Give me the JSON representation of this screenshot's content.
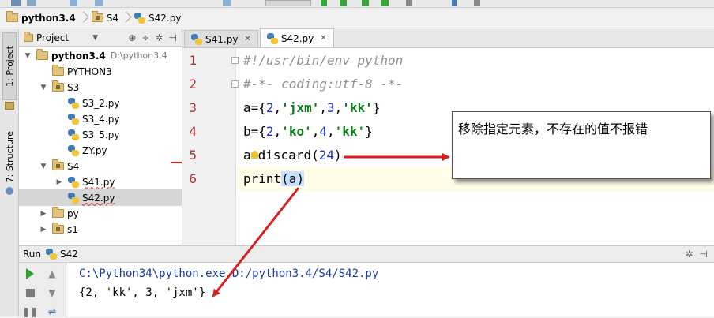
{
  "breadcrumb": {
    "project": "python3.4",
    "folder": "S4",
    "file": "S42.py"
  },
  "left_strip": {
    "project_tab": "1: Project",
    "structure_tab": "7: Structure"
  },
  "project_panel": {
    "title": "Project",
    "tree": [
      {
        "label": "python3.4",
        "hint": "D:\\python3.4",
        "kind": "folder",
        "depth": 0,
        "expanded": true,
        "bold": true
      },
      {
        "label": "PYTHON3",
        "kind": "folder",
        "depth": 1
      },
      {
        "label": "S3",
        "kind": "package",
        "depth": 1,
        "expanded": true
      },
      {
        "label": "S3_2.py",
        "kind": "py",
        "depth": 2
      },
      {
        "label": "S3_4.py",
        "kind": "py",
        "depth": 2
      },
      {
        "label": "S3_5.py",
        "kind": "py",
        "depth": 2
      },
      {
        "label": "ZY.py",
        "kind": "py",
        "depth": 2
      },
      {
        "label": "S4",
        "kind": "package",
        "depth": 1,
        "expanded": true
      },
      {
        "label": "S41.py",
        "kind": "py",
        "depth": 2,
        "collapsed": true
      },
      {
        "label": "S42.py",
        "kind": "py",
        "depth": 2,
        "selected": true
      },
      {
        "label": "py",
        "kind": "folder",
        "depth": 1,
        "collapsed": true
      },
      {
        "label": "s1",
        "kind": "package",
        "depth": 1,
        "collapsed": true
      }
    ]
  },
  "editor": {
    "tabs": [
      {
        "label": "S41.py",
        "active": false
      },
      {
        "label": "S42.py",
        "active": true
      }
    ],
    "line_numbers": [
      "1",
      "2",
      "3",
      "4",
      "5",
      "6"
    ],
    "lines": {
      "l1": "#!/usr/bin/env python",
      "l2": "#-*- coding:utf-8 -*-",
      "l3": {
        "a": "a={",
        "n1": "2",
        "c1": ",",
        "s1": "'jxm'",
        "c2": ",",
        "n2": "3",
        "c3": ",",
        "s2": "'kk'",
        "e": "}"
      },
      "l4": {
        "a": "b={",
        "n1": "2",
        "c1": ",",
        "s1": "'ko'",
        "c2": ",",
        "n2": "4",
        "c3": ",",
        "s2": "'kk'",
        "e": "}"
      },
      "l5": {
        "a": "a",
        "b": "discard(",
        "n": "24",
        "e": ")"
      },
      "l6": {
        "a": "print",
        "p": "(a)"
      }
    }
  },
  "run_panel": {
    "title": "Run",
    "config": "S42",
    "console": [
      "C:\\Python34\\python.exe D:/python3.4/S4/S42.py",
      "{2, 'kk', 3, 'jxm'}"
    ]
  },
  "annotation": {
    "callout_text": "移除指定元素，不存在的值不报错",
    "arrow_color": "#d42020"
  }
}
